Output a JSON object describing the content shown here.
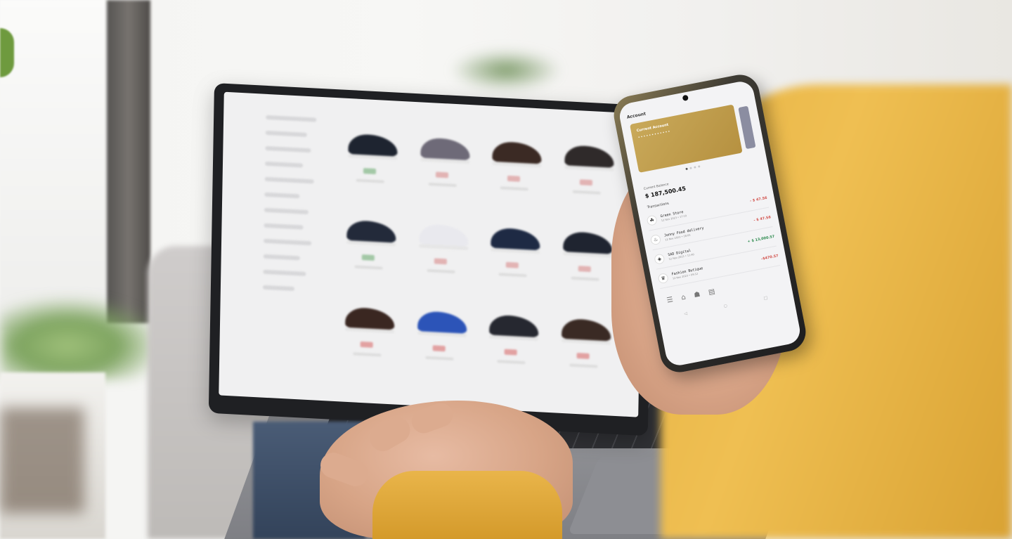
{
  "phone": {
    "app_header": "Account",
    "card": {
      "title": "Current Account",
      "masked_number": "••••••••••••"
    },
    "balance_label": "Current Balance",
    "balance_value": "$ 187,500.45",
    "transactions_label": "Transactions",
    "transactions": [
      {
        "name": "Green Store",
        "date": "12 Nov 2023 • 17:10",
        "amount": "- $ 47.56",
        "kind": "neg",
        "icon": "leaf-icon",
        "glyph": "☘"
      },
      {
        "name": "Jonny Food delivery",
        "date": "12 Nov 2023 • 18:05",
        "amount": "- $ 47.56",
        "kind": "neg",
        "icon": "food-icon",
        "glyph": "♨"
      },
      {
        "name": "SAD Digital",
        "date": "12 Nov 2023 • 11:40",
        "amount": "+ $ 13,000.57",
        "kind": "pos",
        "icon": "digital-icon",
        "glyph": "◈"
      },
      {
        "name": "Fashion Butique",
        "date": "12 Nov 2023 • 09:12",
        "amount": "-$470.57",
        "kind": "neg",
        "icon": "hat-icon",
        "glyph": "♛"
      }
    ],
    "tabbar": [
      {
        "icon": "menu-icon",
        "glyph": "☰"
      },
      {
        "icon": "home-icon",
        "glyph": "⌂"
      },
      {
        "icon": "bank-icon",
        "glyph": "☗"
      },
      {
        "icon": "cards-icon",
        "glyph": "▤"
      }
    ],
    "sysnav": [
      {
        "icon": "back-icon",
        "glyph": "◁"
      },
      {
        "icon": "home-circle-icon",
        "glyph": "○"
      },
      {
        "icon": "recent-icon",
        "glyph": "□"
      }
    ]
  },
  "laptop": {
    "shoes": [
      {
        "color": "#1e2430",
        "price_color": "#6fae74"
      },
      {
        "color": "#6e6a78",
        "price_color": "#d98a8a"
      },
      {
        "color": "#3b2a24",
        "price_color": "#d98a8a"
      },
      {
        "color": "#2f2a2a",
        "price_color": "#d98a8a"
      },
      {
        "color": "#232a3a",
        "price_color": "#6fae74"
      },
      {
        "color": "#e9e9ee",
        "price_color": "#d98a8a"
      },
      {
        "color": "#1e2a44",
        "price_color": "#d98a8a"
      },
      {
        "color": "#1f2430",
        "price_color": "#d98a8a"
      },
      {
        "color": "#3a2721",
        "price_color": "#d96c6c"
      },
      {
        "color": "#2c54b8",
        "price_color": "#d96c6c"
      },
      {
        "color": "#262830",
        "price_color": "#d96c6c"
      },
      {
        "color": "#3a2a24",
        "price_color": "#d96c6c"
      }
    ]
  },
  "colors": {
    "sweater": "#e7b446",
    "card_gold": "#c9a95a",
    "negative": "#d2504b",
    "positive": "#2e8b4f"
  }
}
